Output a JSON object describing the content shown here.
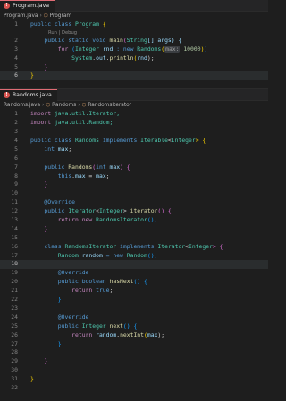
{
  "program_tab": {
    "label": "Program.java",
    "badge": "!"
  },
  "program_breadcrumb": {
    "file": "Program.java",
    "cls": "Program"
  },
  "program_lens": "Run | Debug",
  "program_lines": [
    "1",
    "2",
    "3",
    "4",
    "5",
    "6"
  ],
  "program_code": {
    "l1a": "public class ",
    "l1b": "Program",
    "l1c": " {",
    "l2a": "    public static void ",
    "l2b": "main",
    "l2c": "(",
    "l2d": "String",
    "l2e": "[] args) {",
    "l3a": "        for ",
    "l3b": "(",
    "l3c": "Integer",
    "l3d": " rnd",
    "l3e": " : new ",
    "l3f": "Randoms",
    "l3g": "(",
    "l3h": "max:",
    "l3i": " 10000",
    "l3j": ")",
    "l3k": ")",
    "l4a": "            System",
    "l4b": ".",
    "l4c": "out",
    "l4d": ".",
    "l4e": "println",
    "l4f": "(",
    "l4g": "rnd",
    "l4h": ");",
    "l5": "    }",
    "l6": "}"
  },
  "randoms_tab": {
    "label": "Randoms.java",
    "badge": "!"
  },
  "randoms_breadcrumb": {
    "file": "Randoms.java",
    "cls": "Randoms",
    "inner": "RandomsIterator"
  },
  "randoms_lines": [
    "1",
    "2",
    "3",
    "4",
    "5",
    "6",
    "7",
    "8",
    "9",
    "10",
    "11",
    "12",
    "13",
    "14",
    "15",
    "16",
    "17",
    "18",
    "19",
    "20",
    "21",
    "22",
    "23",
    "24",
    "25",
    "26",
    "27",
    "28",
    "29",
    "30",
    "31",
    "32"
  ],
  "randoms_code": {
    "l1a": "import ",
    "l1b": "java.util.Iterator;",
    "l2a": "import ",
    "l2b": "java.util.Random;",
    "l4a": "public class ",
    "l4b": "Randoms",
    "l4c": " implements ",
    "l4d": "Iterable",
    "l4e": "<",
    "l4f": "Integer",
    "l4g": "> {",
    "l5a": "    int ",
    "l5b": "max",
    "l5c": ";",
    "l7a": "    public ",
    "l7b": "Randoms",
    "l7c": "(",
    "l7d": "int",
    "l7e": " max",
    "l7f": ") {",
    "l8a": "        this",
    "l8b": ".",
    "l8c": "max",
    "l8d": " = ",
    "l8e": "max",
    "l8f": ";",
    "l9": "    }",
    "l11": "    @Override",
    "l12a": "    public ",
    "l12b": "Iterator",
    "l12c": "<",
    "l12d": "Integer",
    "l12e": "> ",
    "l12f": "iterator",
    "l12g": "() {",
    "l13a": "        return new ",
    "l13b": "RandomsIterator",
    "l13c": "();",
    "l14": "    }",
    "l16a": "    class ",
    "l16b": "RandomsIterator",
    "l16c": " implements ",
    "l16d": "Iterator",
    "l16e": "<",
    "l16f": "Integer",
    "l16g": "> {",
    "l17a": "        Random",
    "l17b": " random",
    "l17c": " = new ",
    "l17d": "Random",
    "l17e": "();",
    "l19": "        @Override",
    "l20a": "        public boolean ",
    "l20b": "hasNext",
    "l20c": "() {",
    "l21a": "            return ",
    "l21b": "true",
    "l21c": ";",
    "l22": "        }",
    "l24": "        @Override",
    "l25a": "        public ",
    "l25b": "Integer",
    "l25c": " ",
    "l25d": "next",
    "l25e": "() {",
    "l26a": "            return ",
    "l26b": "random",
    "l26c": ".",
    "l26d": "nextInt",
    "l26e": "(",
    "l26f": "max",
    "l26g": ");",
    "l27": "        }",
    "l29": "    }",
    "l31": "}"
  },
  "colors": {
    "keyword": "#569cd6",
    "type": "#4ec9b0",
    "function": "#dcdcaa",
    "variable": "#9cdcfe",
    "number": "#b5cea8",
    "background": "#1e1e1e"
  }
}
